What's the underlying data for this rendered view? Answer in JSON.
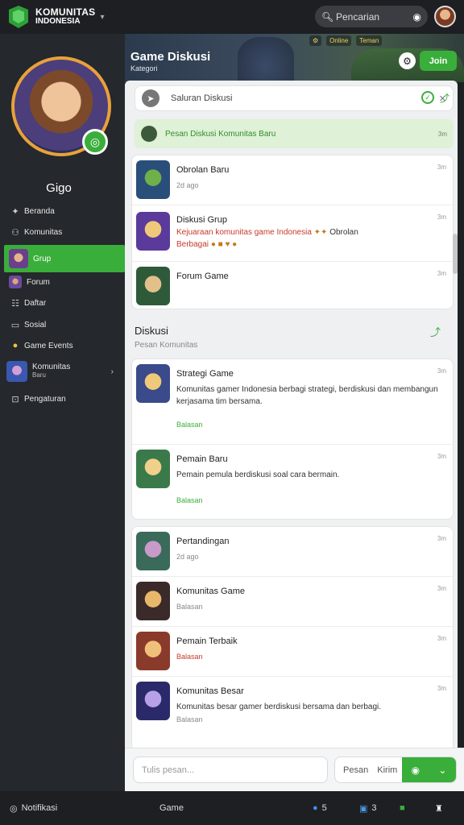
{
  "topbar": {
    "logo_line1": "KOMUNITAS",
    "logo_line2": "INDONESIA",
    "search_text": "Pencarian"
  },
  "banner": {
    "title": "Game Diskusi",
    "subtitle": "Kategori",
    "stats": [
      "⚙",
      "Online",
      "Teman"
    ],
    "join_label": "Join"
  },
  "sidebar": {
    "username": "Gigo",
    "items": [
      {
        "label": "Beranda"
      },
      {
        "label": "Komunitas"
      },
      {
        "label": "Grup"
      },
      {
        "label": "Forum"
      },
      {
        "label": "Daftar"
      },
      {
        "label": "Sosial"
      },
      {
        "label": "Game Events"
      },
      {
        "label": "Komunitas",
        "sub": "Baru"
      },
      {
        "label": "Pengaturan"
      }
    ]
  },
  "main": {
    "search_label": "Saluran Diskusi",
    "pinned_text": "Pesan Diskusi Komunitas  Baru",
    "pinned_time": "3m",
    "top_messages": [
      {
        "name": "Obrolan Baru",
        "sub": "2d ago",
        "time": "3m"
      },
      {
        "name": "Diskusi Grup",
        "body_red": "Kejuaraan komunitas game Indonesia",
        "body_red2": "Berbagai",
        "body_tail": "Obrolan",
        "time": "3m"
      },
      {
        "name": "Forum Game",
        "sub": "",
        "time": "3m"
      }
    ],
    "section_title": "Diskusi",
    "section_sub": "Pesan Komunitas",
    "mid_messages": [
      {
        "name": "Strategi Game",
        "body": "Komunitas gamer Indonesia berbagi strategi, berdiskusi dan membangun kerjasama tim bersama.",
        "link": "Balasan",
        "time": "3m"
      },
      {
        "name": "Pemain Baru",
        "body": "Pemain pemula berdiskusi soal cara bermain.",
        "link": "Balasan",
        "time": "3m"
      }
    ],
    "bottom_messages": [
      {
        "name": "Pertandingan",
        "sub": "2d ago",
        "time": "3m"
      },
      {
        "name": "Komunitas Game",
        "sub": "Balasan",
        "time": "3m"
      },
      {
        "name": "Pemain Terbaik",
        "sub": "Balasan",
        "time": "3m"
      },
      {
        "name": "Komunitas Besar",
        "body": "Komunitas besar gamer berdiskusi bersama dan berbagi.",
        "sub": "Balasan",
        "time": "3m"
      }
    ]
  },
  "composer": {
    "placeholder": "Tulis pesan...",
    "split_label": "Pesan",
    "split_label2": "Kirim"
  },
  "bottombar": {
    "left": "Notifikasi",
    "center": "Game",
    "count1": "5",
    "count2": "3"
  },
  "colors": {
    "accent": "#3aae3a",
    "sidebar": "#25282c",
    "topbar": "#1d1f22"
  }
}
